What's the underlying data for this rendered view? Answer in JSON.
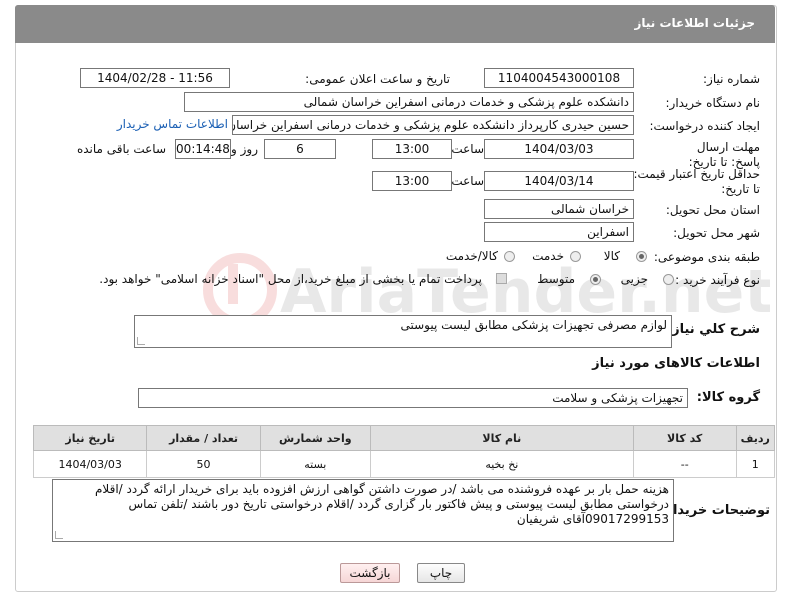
{
  "header": {
    "title": "جزئیات اطلاعات نیاز"
  },
  "form": {
    "need_number_label": "شماره نیاز:",
    "need_number": "1104004543000108",
    "announce_label": "تاریخ و ساعت اعلان عمومی:",
    "announce_value": "1404/02/28 - 11:56",
    "buyer_org_label": "نام دستگاه خریدار:",
    "buyer_org": "دانشکده علوم پزشکی و خدمات درمانی اسفراین خراسان شمالی",
    "creator_label": "ایجاد کننده درخواست:",
    "creator": "حسین  حیدری کارپرداز دانشکده علوم پزشکی و خدمات درمانی اسفراین خراسان",
    "contact_link": "اطلاعات تماس خریدار",
    "deadline_label": "مهلت ارسال پاسخ: تا تاریخ:",
    "deadline_date": "1404/03/03",
    "time_label": "ساعت",
    "deadline_time": "13:00",
    "days_value": "6",
    "days_label": "روز و",
    "remaining_value": "00:14:48",
    "remaining_label": "ساعت باقی مانده",
    "price_label": "حداقل تاریخ اعتبار قیمت: تا تاریخ:",
    "price_date": "1404/03/14",
    "price_time": "13:00",
    "province_label": "استان محل تحویل:",
    "province": "خراسان شمالی",
    "city_label": "شهر محل تحویل:",
    "city": "اسفراین",
    "category_label": "طبقه بندی موضوعی:",
    "category_options": [
      "کالا",
      "خدمت",
      "کالا/خدمت"
    ],
    "process_label": "نوع فرآیند خرید :",
    "process_options": [
      "جزیی",
      "متوسط"
    ],
    "payment_note": "پرداخت تمام یا بخشی از مبلغ خرید،از محل \"اسناد خزانه اسلامی\" خواهد بود.",
    "description_label": "شرح کلي نياز:",
    "description": "لوازم مصرفی تجهیزات پزشکی مطابق لیست پیوستی",
    "goods_info_title": "اطلاعات کالاهای مورد نیاز",
    "group_label": "گروه کالا:",
    "group_value": "تجهیزات پزشکی و سلامت",
    "buyer_notes_label": "توضیحات خریدار:",
    "buyer_notes": "هزینه حمل بار بر عهده فروشنده می باشد /در صورت داشتن گواهی ارزش افزوده باید برای خریدار ارائه گردد /اقلام درخواستی مطابق لیست پیوستی و پیش فاکتور بار گزاری گردد /اقلام درخواستی تاریخ دور باشند /تلفن تماس 09017299153آقای شریفیان"
  },
  "table": {
    "headers": [
      "ردیف",
      "کد کالا",
      "نام کالا",
      "واحد شمارش",
      "تعداد / مقدار",
      "تاریخ نیاز"
    ],
    "rows": [
      [
        "1",
        "--",
        "نخ بخیه",
        "بسته",
        "50",
        "1404/03/03"
      ]
    ]
  },
  "buttons": {
    "print": "چاپ",
    "back": "بازگشت"
  },
  "watermark": {
    "text": "AriaTender.net"
  }
}
